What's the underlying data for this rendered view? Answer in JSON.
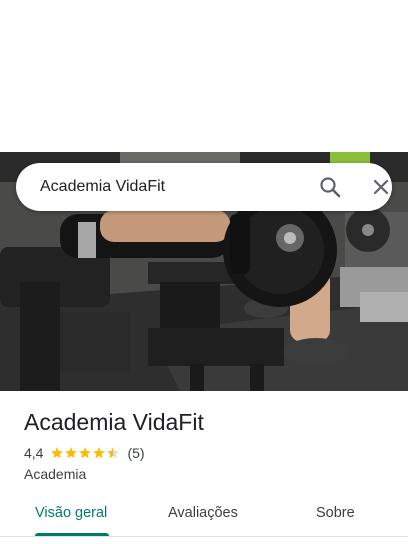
{
  "search": {
    "query": "Academia VidaFit"
  },
  "place": {
    "name": "Academia VidaFit",
    "rating": "4,4",
    "stars": 4.4,
    "review_count": "(5)",
    "category": "Academia"
  },
  "tabs": [
    {
      "label": "Visão geral",
      "active": true
    },
    {
      "label": "Avaliações",
      "active": false
    },
    {
      "label": "Sobre",
      "active": false
    }
  ],
  "colors": {
    "accent": "#00796b",
    "star": "#fbbc04"
  },
  "icons": [
    "search-icon",
    "close-icon",
    "star-icon"
  ]
}
